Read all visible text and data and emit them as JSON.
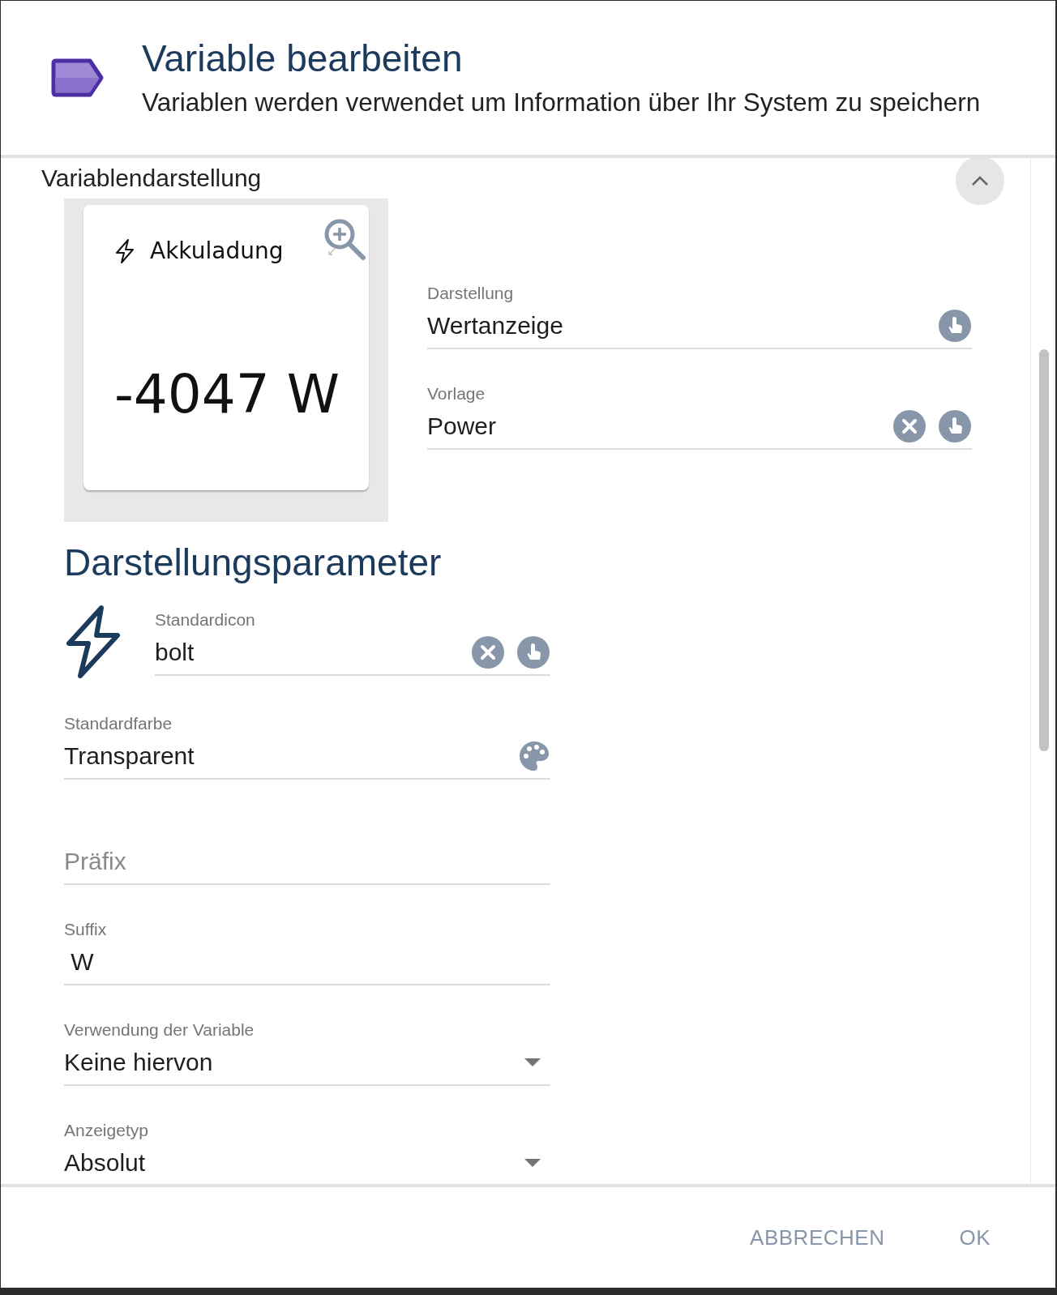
{
  "dialog": {
    "title": "Variable bearbeiten",
    "subtitle": "Variablen werden verwendet um Information über Ihr System zu speichern"
  },
  "section": {
    "title": "Variablendarstellung",
    "expanded": true
  },
  "preview": {
    "card_title": "Akkuladung",
    "card_value": "-4047 W"
  },
  "presentation_fields": [
    {
      "label": "Darstellung",
      "value": "Wertanzeige",
      "kind": "input",
      "pickable": true
    },
    {
      "label": "Vorlage",
      "value": "Power",
      "kind": "input",
      "clearable": true,
      "pickable": true
    }
  ],
  "parameters": {
    "heading": "Darstellungsparameter",
    "icon_field": {
      "label": "Standardicon",
      "value": "bolt",
      "kind": "input",
      "clearable": true,
      "pickable": true
    },
    "fields": [
      {
        "label": "Standardfarbe",
        "value": "Transparent",
        "kind": "color"
      },
      {
        "placeholder": "Präfix",
        "kind": "input"
      },
      {
        "label": "Suffix",
        "value": " W",
        "kind": "input"
      },
      {
        "label": "Verwendung der Variable",
        "value": "Keine hiervon",
        "kind": "select"
      },
      {
        "label": "Anzeigetyp",
        "value": "Absolut",
        "kind": "select"
      }
    ]
  },
  "buttons": [
    {
      "label": "ABBRECHEN"
    },
    {
      "label": "OK"
    }
  ]
}
